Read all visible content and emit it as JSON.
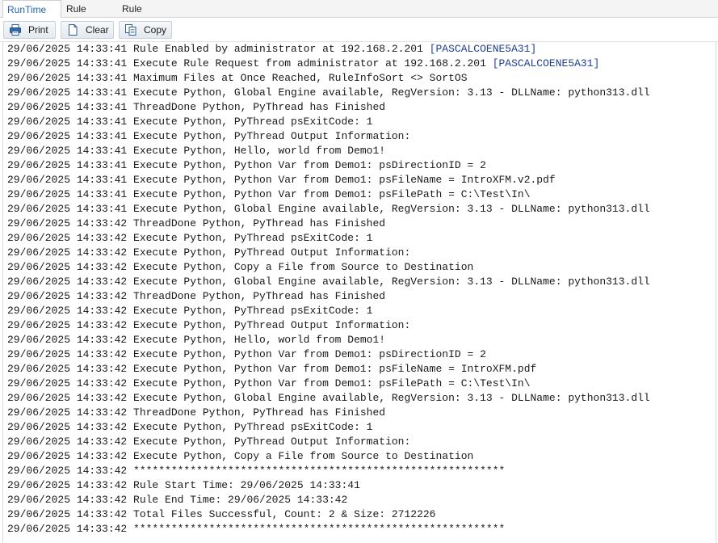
{
  "tabs": [
    {
      "label": "RunTime Log",
      "active": true
    },
    {
      "label": "Rule Report",
      "active": false
    },
    {
      "label": "Rule Info",
      "active": false
    }
  ],
  "toolbar": {
    "print_label": "Print",
    "clear_label": "Clear",
    "copy_label": "Copy"
  },
  "icons": {
    "print": "printer-icon",
    "clear": "blank-page-icon",
    "copy": "copy-pages-icon"
  },
  "colors": {
    "active_tab": "#1f66c7",
    "host_tag": "#1d3fa3",
    "log_text": "#1a1a1a"
  },
  "log_lines": [
    {
      "text": "29/06/2025 14:33:41 Rule Enabled by administrator at 192.168.2.201 ",
      "tag": "[PASCALCOENE5A31]"
    },
    {
      "text": "29/06/2025 14:33:41 Execute Rule Request from administrator at 192.168.2.201 ",
      "tag": "[PASCALCOENE5A31]"
    },
    {
      "text": "29/06/2025 14:33:41 Maximum Files at Once Reached, RuleInfoSort <> SortOS",
      "tag": ""
    },
    {
      "text": "29/06/2025 14:33:41 Execute Python, Global Engine available, RegVersion: 3.13 - DLLName: python313.dll",
      "tag": ""
    },
    {
      "text": "29/06/2025 14:33:41 ThreadDone Python, PyThread has Finished",
      "tag": ""
    },
    {
      "text": "29/06/2025 14:33:41 Execute Python, PyThread psExitCode: 1",
      "tag": ""
    },
    {
      "text": "29/06/2025 14:33:41 Execute Python, PyThread Output Information:",
      "tag": ""
    },
    {
      "text": "29/06/2025 14:33:41 Execute Python, Hello, world from Demo1!",
      "tag": ""
    },
    {
      "text": "29/06/2025 14:33:41 Execute Python, Python Var from Demo1: psDirectionID = 2",
      "tag": ""
    },
    {
      "text": "29/06/2025 14:33:41 Execute Python, Python Var from Demo1: psFileName = IntroXFM.v2.pdf",
      "tag": ""
    },
    {
      "text": "29/06/2025 14:33:41 Execute Python, Python Var from Demo1: psFilePath = C:\\Test\\In\\",
      "tag": ""
    },
    {
      "text": "29/06/2025 14:33:41 Execute Python, Global Engine available, RegVersion: 3.13 - DLLName: python313.dll",
      "tag": ""
    },
    {
      "text": "29/06/2025 14:33:42 ThreadDone Python, PyThread has Finished",
      "tag": ""
    },
    {
      "text": "29/06/2025 14:33:42 Execute Python, PyThread psExitCode: 1",
      "tag": ""
    },
    {
      "text": "29/06/2025 14:33:42 Execute Python, PyThread Output Information:",
      "tag": ""
    },
    {
      "text": "29/06/2025 14:33:42 Execute Python, Copy a File from Source to Destination",
      "tag": ""
    },
    {
      "text": "29/06/2025 14:33:42 Execute Python, Global Engine available, RegVersion: 3.13 - DLLName: python313.dll",
      "tag": ""
    },
    {
      "text": "29/06/2025 14:33:42 ThreadDone Python, PyThread has Finished",
      "tag": ""
    },
    {
      "text": "29/06/2025 14:33:42 Execute Python, PyThread psExitCode: 1",
      "tag": ""
    },
    {
      "text": "29/06/2025 14:33:42 Execute Python, PyThread Output Information:",
      "tag": ""
    },
    {
      "text": "29/06/2025 14:33:42 Execute Python, Hello, world from Demo1!",
      "tag": ""
    },
    {
      "text": "29/06/2025 14:33:42 Execute Python, Python Var from Demo1: psDirectionID = 2",
      "tag": ""
    },
    {
      "text": "29/06/2025 14:33:42 Execute Python, Python Var from Demo1: psFileName = IntroXFM.pdf",
      "tag": ""
    },
    {
      "text": "29/06/2025 14:33:42 Execute Python, Python Var from Demo1: psFilePath = C:\\Test\\In\\",
      "tag": ""
    },
    {
      "text": "29/06/2025 14:33:42 Execute Python, Global Engine available, RegVersion: 3.13 - DLLName: python313.dll",
      "tag": ""
    },
    {
      "text": "29/06/2025 14:33:42 ThreadDone Python, PyThread has Finished",
      "tag": ""
    },
    {
      "text": "29/06/2025 14:33:42 Execute Python, PyThread psExitCode: 1",
      "tag": ""
    },
    {
      "text": "29/06/2025 14:33:42 Execute Python, PyThread Output Information:",
      "tag": ""
    },
    {
      "text": "29/06/2025 14:33:42 Execute Python, Copy a File from Source to Destination",
      "tag": ""
    },
    {
      "text": "29/06/2025 14:33:42 ***********************************************************",
      "tag": ""
    },
    {
      "text": "29/06/2025 14:33:42 Rule Start Time: 29/06/2025 14:33:41",
      "tag": ""
    },
    {
      "text": "29/06/2025 14:33:42 Rule End Time: 29/06/2025 14:33:42",
      "tag": ""
    },
    {
      "text": "29/06/2025 14:33:42 Total Files Successful, Count: 2 & Size: 2712226",
      "tag": ""
    },
    {
      "text": "29/06/2025 14:33:42 ***********************************************************",
      "tag": ""
    }
  ]
}
